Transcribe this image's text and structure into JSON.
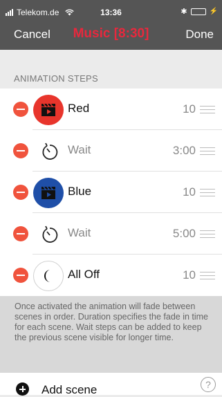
{
  "status_bar": {
    "carrier": "Telekom.de",
    "time": "13:36",
    "signal_icon": "signal-bars-icon",
    "wifi_icon": "wifi-icon",
    "bluetooth_icon": "bluetooth-icon",
    "battery_icon": "battery-icon",
    "charging_icon": "charging-bolt-icon",
    "battery_level": 1.0,
    "battery_color": "#4cd964"
  },
  "nav": {
    "cancel_label": "Cancel",
    "title": "Music [8:30]",
    "done_label": "Done",
    "title_color": "#e8283d",
    "bar_color": "#555555"
  },
  "section": {
    "header": "ANIMATION STEPS"
  },
  "steps": [
    {
      "label": "Red",
      "duration": "10",
      "icon": "clapperboard-icon",
      "circle_color": "#e8352c"
    },
    {
      "label": "Wait",
      "duration": "3:00",
      "icon": "timer-icon"
    },
    {
      "label": "Blue",
      "duration": "10",
      "icon": "clapperboard-icon",
      "circle_color": "#1f4fa8"
    },
    {
      "label": "Wait",
      "duration": "5:00",
      "icon": "timer-icon"
    },
    {
      "label": "All Off",
      "duration": "10",
      "icon": "moon-icon"
    }
  ],
  "delete_color": "#f0533d",
  "info_text": "Once activated the animation will fade between scenes in order. Duration specifies the fade in time for each scene. Wait steps can be added to keep the previous scene visible for longer time.",
  "add_scene_label": "Add scene",
  "help_label": "?"
}
